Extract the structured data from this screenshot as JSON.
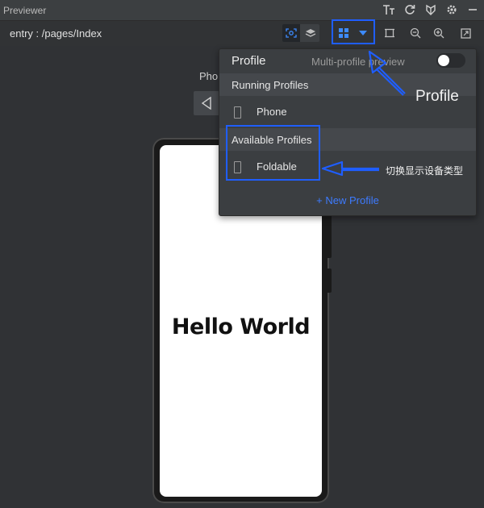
{
  "titlebar": {
    "title": "Previewer",
    "icons": [
      "font-size-icon",
      "refresh-icon",
      "plugin-icon",
      "settings-icon",
      "minimize-icon"
    ]
  },
  "toolbar": {
    "path": "entry : /pages/Index"
  },
  "canvas": {
    "device_label": "Pho"
  },
  "phone": {
    "text": "Hello World"
  },
  "profile_dropdown": {
    "title": "Profile",
    "multi_profile_label": "Multi-profile preview",
    "multi_profile_enabled": false,
    "running_profiles_header": "Running Profiles",
    "running_profiles": [
      "Phone"
    ],
    "available_profiles_header": "Available Profiles",
    "available_profiles": [
      "Foldable"
    ],
    "new_profile_label": "+ New Profile"
  },
  "annotations": {
    "profile_label": "Profile",
    "switch_device_label": "切换显示设备类型"
  },
  "colors": {
    "highlight": "#1f5eff",
    "link": "#3d7bff",
    "background": "#3c3f41"
  }
}
